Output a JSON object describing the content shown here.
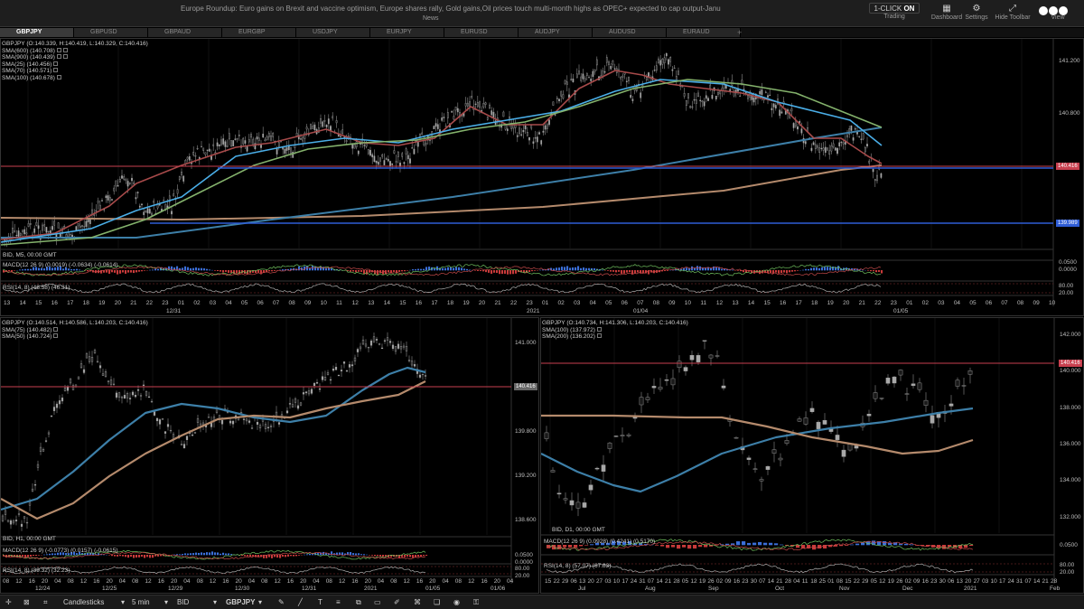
{
  "topbar": {
    "news_ticker": "Europe Roundup: Euro gains  on Brexit and vaccine optimism, Europe shares rally, Gold gains,Oil prices touch multi-month highs as OPEC+ expected to cap output-Janu",
    "news_label": "News",
    "oneclick_prefix": "1-CLICK",
    "oneclick_state": "ON",
    "trading_label": "Trading",
    "dashboard_label": "Dashboard",
    "settings_label": "Settings",
    "hide_toolbar_label": "Hide Toolbar",
    "view_label": "View"
  },
  "tabs": [
    "GBPJPY",
    "GBPUSD",
    "GBPAUD",
    "EURGBP",
    "USDJPY",
    "EURJPY",
    "EURUSD",
    "AUDJPY",
    "AUDUSD",
    "EURAUD"
  ],
  "tab_add": "+",
  "colors": {
    "sma600": "#b48a6c",
    "sma900": "#3d7fa8",
    "sma25": "#a74a4a",
    "sma70": "#4aaee8",
    "sma100": "#84b26c",
    "price_line": "#c8404f",
    "blue_level": "#2f5dd6",
    "candles": "#a8a8a8"
  },
  "top": {
    "legend": [
      "GBPJPY (O:140.339, H:140.419, L:140.329, C:140.416)",
      "SMA(600) (140.708)",
      "SMA(900) (140.439)",
      "SMA(25) (140.456)",
      "SMA(70) (140.571)",
      "SMA(100) (140.678)"
    ],
    "bid": "BID, M5, 00:00 GMT",
    "macd": "MACD(12 26 9) (0.0019) (-0.0634) (-0.0614)",
    "rsi": "RSI(14, 8) (46.58) (46.31)",
    "price_tag": "140.416",
    "level_tag": "139.989",
    "yticks": [
      "141.200",
      "140.800"
    ],
    "macd_ticks": [
      "0.0500",
      "0.0000"
    ],
    "rsi_ticks": [
      "80.00",
      "20.00"
    ],
    "xticks": [
      "13",
      "14",
      "15",
      "16",
      "17",
      "18",
      "19",
      "20",
      "21",
      "22",
      "23",
      "01",
      "02",
      "03",
      "04",
      "05",
      "06",
      "07",
      "08",
      "09",
      "10",
      "11",
      "12",
      "13",
      "14",
      "15",
      "16",
      "17",
      "18",
      "19",
      "20",
      "21",
      "22",
      "23",
      "01",
      "02",
      "03",
      "04",
      "05",
      "06",
      "07",
      "08",
      "09",
      "10",
      "11",
      "12",
      "13",
      "14",
      "15",
      "16",
      "17",
      "18",
      "19",
      "20",
      "21",
      "22",
      "23",
      "01",
      "02",
      "03",
      "04",
      "05",
      "06",
      "07",
      "08",
      "09",
      "10"
    ],
    "date_labels": [
      "12/31",
      "2021",
      "01/04",
      "01/05"
    ]
  },
  "left": {
    "legend": [
      "GBPJPY (O:140.514, H:140.586, L:140.203, C:140.416)",
      "SMA(75) (140.482)",
      "SMA(50) (140.724)"
    ],
    "bid": "BID, H1, 00:00 GMT",
    "macd": "MACD(12 26 9) (-0.0773) (0.0157) (-0.0615)",
    "rsi": "RSI(14, 8) (39.32) (32.23)",
    "price_tag": "140.416",
    "yticks": [
      "141.000",
      "139.800",
      "139.200",
      "138.600"
    ],
    "extra_ytick": "140.400",
    "macd_ticks": [
      "0.0500",
      "0.0000"
    ],
    "rsi_ticks": [
      "80.00",
      "20.00"
    ],
    "xticks": [
      "08",
      "12",
      "16",
      "20",
      "04",
      "08",
      "12",
      "16",
      "20",
      "04",
      "08",
      "12",
      "16",
      "20",
      "04",
      "08",
      "12",
      "16",
      "20",
      "04",
      "08",
      "12",
      "16",
      "20",
      "04",
      "08",
      "12",
      "16",
      "20",
      "04",
      "08",
      "12",
      "16",
      "20",
      "04",
      "08",
      "12",
      "16",
      "20",
      "04"
    ],
    "date_labels": [
      "12/24",
      "12/25",
      "12/29",
      "12/30",
      "12/31",
      "2021",
      "01/05",
      "01/06"
    ]
  },
  "right": {
    "legend": [
      "GBPJPY (O:140.734, H:141.306, L:140.203, C:140.416)",
      "SMA(100) (137.972)",
      "SMA(200) (136.202)"
    ],
    "bid": "BID, D1, 00:00 GMT",
    "macd": "MACD(12 26 9) (0.0928) (0.4241) (0.5170)",
    "rsi": "RSI(14, 8) (57.07) (67.83)",
    "price_tag": "140.416",
    "yticks": [
      "142.000",
      "140.000",
      "138.000",
      "136.000",
      "134.000",
      "132.000"
    ],
    "macd_ticks": [
      "0.0500"
    ],
    "rsi_ticks": [
      "80.00",
      "20.00"
    ],
    "xticks": [
      "15",
      "22",
      "29",
      "06",
      "13",
      "20",
      "27",
      "03",
      "10",
      "17",
      "24",
      "31",
      "07",
      "14",
      "21",
      "28",
      "05",
      "12",
      "19",
      "26",
      "02",
      "09",
      "16",
      "23",
      "30",
      "07",
      "14",
      "21",
      "28",
      "04",
      "11",
      "18",
      "25",
      "01",
      "08",
      "15",
      "22",
      "29",
      "05",
      "12",
      "19",
      "26",
      "02",
      "09",
      "16",
      "23",
      "30",
      "06",
      "13",
      "20",
      "27",
      "03",
      "10",
      "17",
      "24",
      "31",
      "07",
      "14",
      "21",
      "28"
    ],
    "month_labels": [
      "Jul",
      "Aug",
      "Sep",
      "Oct",
      "Nov",
      "Dec",
      "2021",
      "Feb"
    ]
  },
  "bottombar": {
    "chart_type": "Candlesticks",
    "timeframe": "5 min",
    "price_side": "BID",
    "symbol": "GBPJPY"
  }
}
